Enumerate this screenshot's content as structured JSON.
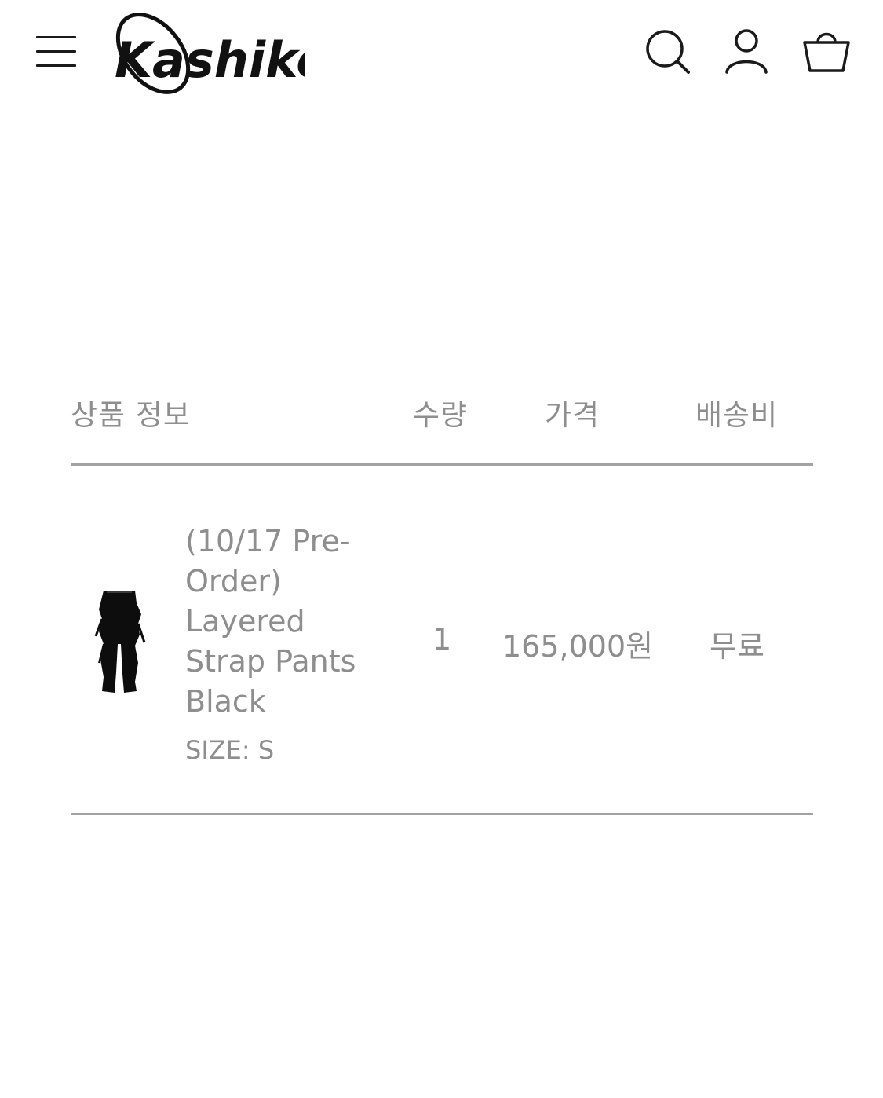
{
  "header": {
    "logo_text": "Kashiko",
    "menu_icon": "hamburger-menu-icon",
    "search_icon": "search-icon",
    "account_icon": "user-icon",
    "cart_icon": "shopping-bag-icon"
  },
  "cart": {
    "columns": {
      "product_info": "상품 정보",
      "quantity": "수량",
      "price": "가격",
      "shipping": "배송비"
    },
    "items": [
      {
        "name": "(10/17 Pre-Order) Layered Strap Pants Black",
        "option": "SIZE: S",
        "quantity": "1",
        "price": "165,000원",
        "shipping": "무료"
      }
    ]
  },
  "colors": {
    "text_muted": "#8e8e8e",
    "rule": "#a3a3a3",
    "icon": "#1a1a1a"
  }
}
